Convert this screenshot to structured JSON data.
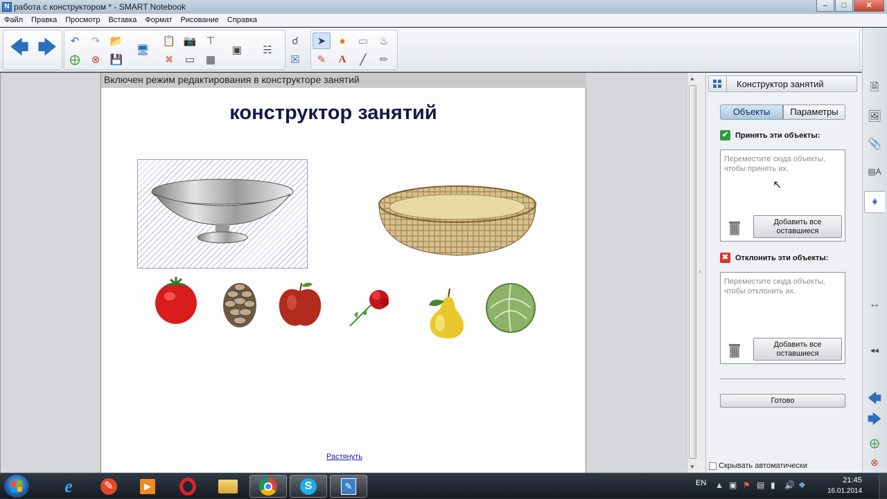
{
  "window": {
    "title": "работа с конструктором * - SMART Notebook",
    "buttons": [
      "minimize",
      "maximize",
      "close"
    ]
  },
  "menu": [
    "Файл",
    "Правка",
    "Просмотр",
    "Вставка",
    "Формат",
    "Рисование",
    "Справка"
  ],
  "page": {
    "banner": "Включен режим редактирования в конструкторе занятий",
    "title": "конструктор занятий",
    "stretch_link": "Растянуть",
    "containers": [
      "silver-bowl",
      "wicker-basket"
    ],
    "objects": [
      "tomato",
      "pine-cone",
      "apple",
      "carnation",
      "pear",
      "cabbage"
    ]
  },
  "panel": {
    "header": "Конструктор занятий",
    "tabs": [
      "Объекты",
      "Параметры"
    ],
    "active_tab": "Объекты",
    "accept": {
      "label": "Принять эти объекты:",
      "placeholder": "Переместите сюда объекты, чтобы принять их.",
      "add_all": "Добавить все оставшиеся"
    },
    "reject": {
      "label": "Отклонить эти объекты:",
      "placeholder": "Переместите сюда объекты, чтобы отклонить их.",
      "add_all": "Добавить все оставшиеся"
    },
    "done": "Готово",
    "autohide": "Скрывать автоматически"
  },
  "taskbar": {
    "apps": [
      "internet-explorer",
      "smart-tools",
      "media-player",
      "opera",
      "explorer",
      "chrome",
      "skype",
      "smart-notebook"
    ],
    "active_app": "smart-notebook",
    "lang": "EN",
    "time": "21:45",
    "date": "16.01.2014"
  },
  "colors": {
    "title_text": "#16184a",
    "accept_icon": "#2f9a45",
    "reject_icon": "#d9362b",
    "toolbar_arrows": "#2b6fbd"
  }
}
